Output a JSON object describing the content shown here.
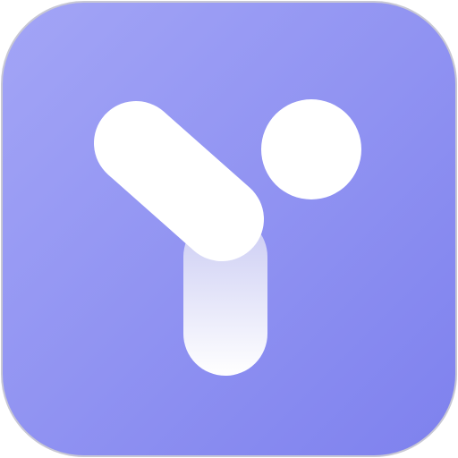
{
  "app_icon": {
    "icon": "y-logo-icon",
    "colors": {
      "tile_light": "#a3a5f6",
      "tile_dark": "#7e81ee",
      "tile_border": "#c8c8d4",
      "glyph": "#ffffff",
      "glyph_shadow": "#c9caf3"
    }
  }
}
